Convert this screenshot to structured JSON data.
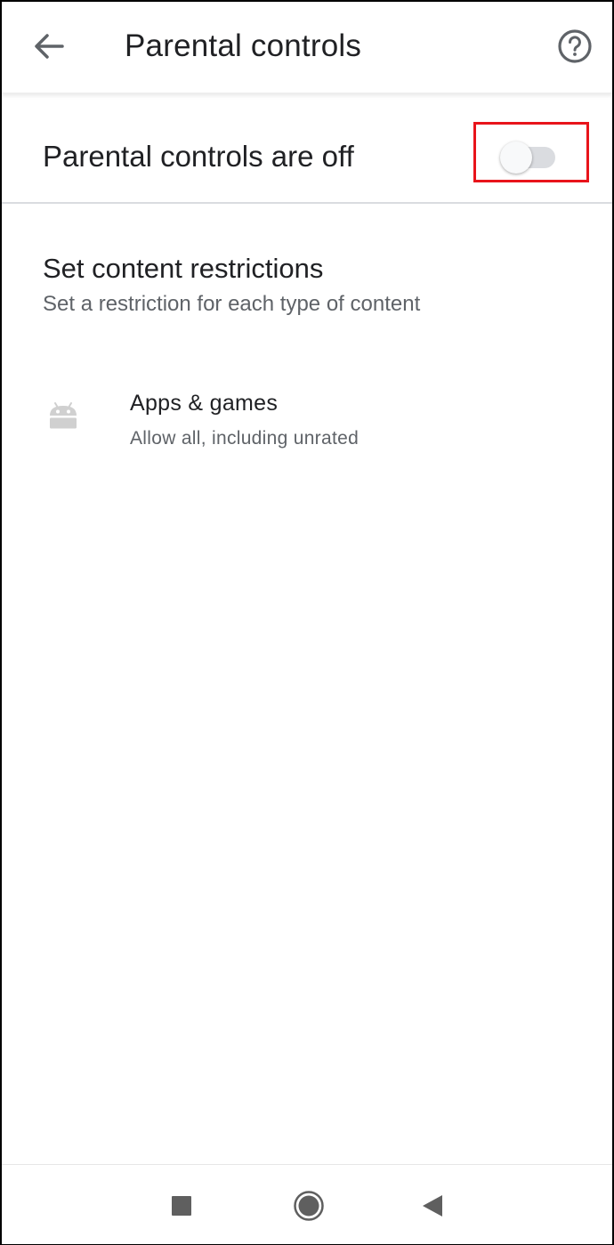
{
  "header": {
    "title": "Parental controls",
    "back_icon": "arrow-left-icon",
    "help_icon": "help-circle-icon"
  },
  "master_toggle": {
    "label": "Parental controls are off",
    "state": "off",
    "highlight_color": "#e8141b"
  },
  "content_restrictions": {
    "title": "Set content restrictions",
    "subtitle": "Set a restriction for each type of content",
    "items": [
      {
        "icon": "android-icon",
        "title": "Apps & games",
        "subtitle": "Allow all, including unrated"
      }
    ]
  },
  "system_nav": {
    "recents_icon": "square-icon",
    "home_icon": "circle-icon",
    "back_icon": "triangle-left-icon"
  }
}
